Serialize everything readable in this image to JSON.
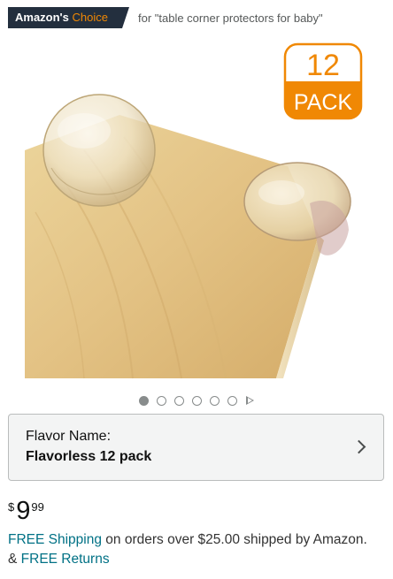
{
  "badge": {
    "amazon_text": "Amazon's",
    "choice_text": "Choice",
    "for_text": "for \"table corner protectors for baby\""
  },
  "product_image": {
    "pack_number": "12",
    "pack_word": "PACK",
    "accent_color": "#f08804"
  },
  "carousel": {
    "total_images": 6,
    "active_index": 0,
    "has_video": true
  },
  "variation": {
    "label": "Flavor Name:",
    "value": "Flavorless 12 pack"
  },
  "price": {
    "symbol": "$",
    "whole": "9",
    "fraction": "99"
  },
  "shipping": {
    "free_shipping_link": "FREE Shipping",
    "middle_text": " on orders over $25.00 shipped by Amazon. & ",
    "free_returns_link": "FREE Returns"
  },
  "colors": {
    "badge_bg": "#232f3e",
    "link": "#007185",
    "dot": "#888c8c"
  }
}
